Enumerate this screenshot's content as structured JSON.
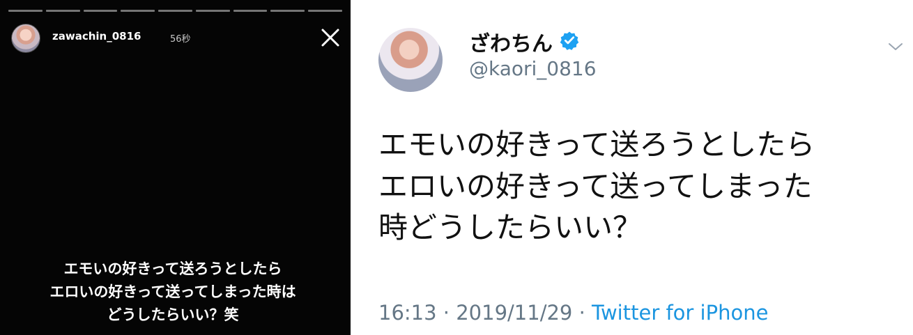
{
  "story": {
    "progress_segments": 9,
    "username": "zawachin_0816",
    "time": "56秒",
    "caption_lines": [
      "エモいの好きって送ろうとしたら",
      "エロいの好きって送ってしまった時は",
      "どうしたらいい？笑"
    ],
    "background_color": "#050505",
    "close_icon": "close-icon"
  },
  "tweet": {
    "display_name": "ざわちん",
    "handle": "@kaori_0816",
    "verified_icon": "verified-badge-icon",
    "menu_icon": "chevron-down-icon",
    "body_lines": [
      "エモいの好きって送ろうとしたら",
      "エロいの好きって送ってしまった",
      "時どうしたらいい？"
    ],
    "time": "16:13",
    "separator": " · ",
    "date": "2019/11/29",
    "source": "Twitter for iPhone",
    "colors": {
      "muted": "#657786",
      "link": "#1b95e0",
      "verified": "#1da1f2"
    }
  }
}
